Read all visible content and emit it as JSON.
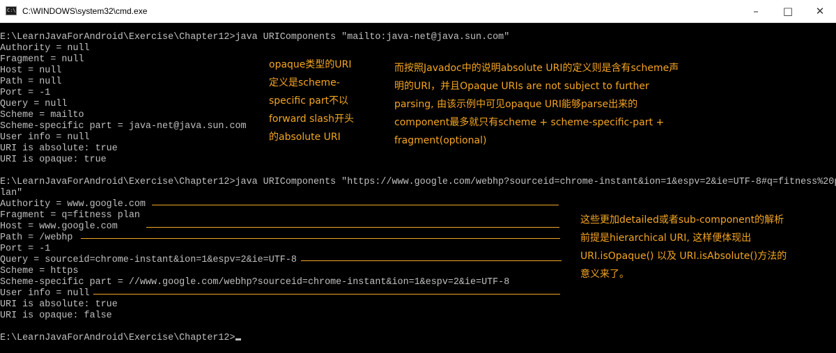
{
  "window": {
    "title": "C:\\WINDOWS\\system32\\cmd.exe",
    "icon": "cmd-icon",
    "icon_text": "C:\\",
    "controls": {
      "minimize": "–",
      "maximize": "□",
      "close": "✕"
    }
  },
  "terminal_lines": [
    "E:\\LearnJavaForAndroid\\Exercise\\Chapter12>java URIComponents \"mailto:java-net@java.sun.com\"",
    "Authority = null",
    "Fragment = null",
    "Host = null",
    "Path = null",
    "Port = -1",
    "Query = null",
    "Scheme = mailto",
    "Scheme-specific part = java-net@java.sun.com",
    "User info = null",
    "URI is absolute: true",
    "URI is opaque: true",
    "",
    "E:\\LearnJavaForAndroid\\Exercise\\Chapter12>java URIComponents \"https://www.google.com/webhp?sourceid=chrome-instant&ion=1&espv=2&ie=UTF-8#q=fitness%20p",
    "lan\"",
    "Authority = www.google.com",
    "Fragment = q=fitness plan",
    "Host = www.google.com",
    "Path = /webhp",
    "Port = -1",
    "Query = sourceid=chrome-instant&ion=1&espv=2&ie=UTF-8",
    "Scheme = https",
    "Scheme-specific part = //www.google.com/webhp?sourceid=chrome-instant&ion=1&espv=2&ie=UTF-8",
    "User info = null",
    "URI is absolute: true",
    "URI is opaque: false",
    ""
  ],
  "prompt_final": "E:\\LearnJavaForAndroid\\Exercise\\Chapter12>",
  "annotations": {
    "opaque_note": [
      "opaque类型的URI",
      "定义是scheme-",
      "specific part不以",
      "forward slash开头",
      "的absolute URI"
    ],
    "javadoc_note": [
      "而按照Javadoc中的说明absolute URI的定义则是含有scheme声",
      "明的URI，并且Opaque URIs are not subject to further",
      "parsing, 由该示例中可见opaque URI能够parse出来的",
      "component最多就只有scheme + scheme-specific-part +",
      "fragment(optional)"
    ],
    "hierarchical_note": [
      "这些更加detailed或者sub-component的解析",
      "前提是hierarchical URI, 这样便体现出",
      "URI.isOpaque() 以及 URI.isAbsolute()方法的",
      "意义来了。"
    ]
  },
  "colors": {
    "background": "#000000",
    "text": "#c0c0c0",
    "annotation": "#f5a623",
    "titlebar": "#ffffff"
  }
}
